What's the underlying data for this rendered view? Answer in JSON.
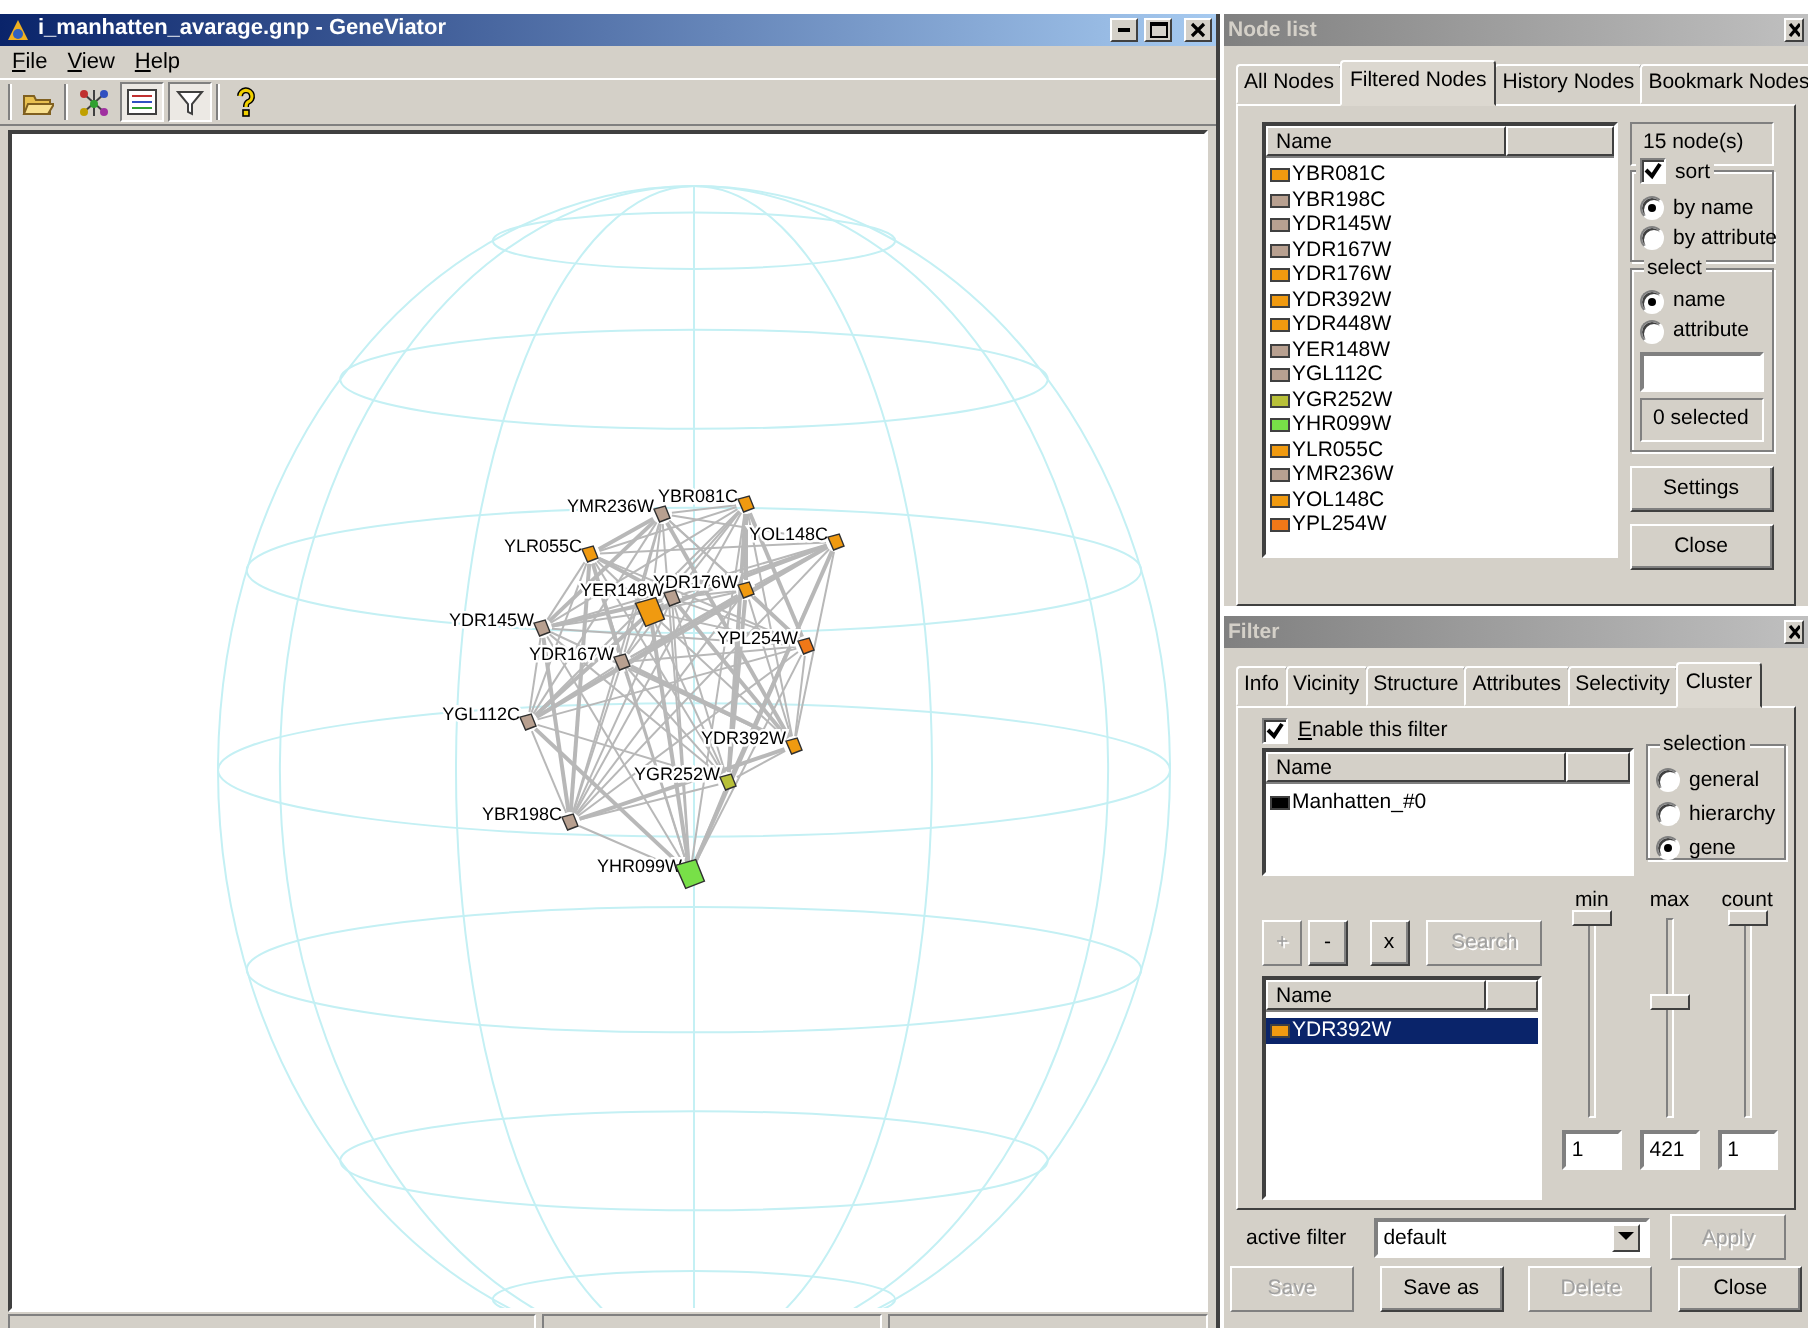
{
  "main_window": {
    "title": "i_manhatten_avarage.gnp - GeneViator",
    "menu": [
      "File",
      "View",
      "Help"
    ],
    "toolbar": [
      {
        "kind": "open",
        "pressed": false
      },
      {
        "kind": "layout",
        "pressed": false
      },
      {
        "kind": "list",
        "pressed": true
      },
      {
        "kind": "filter",
        "pressed": true
      },
      {
        "kind": "help",
        "pressed": false
      }
    ],
    "graph": {
      "nodes": [
        {
          "label": "YBR081C",
          "color": "#f09a10"
        },
        {
          "label": "YMR236W",
          "color": "#b8a090"
        },
        {
          "label": "YOL148C",
          "color": "#f09a10"
        },
        {
          "label": "YLR055C",
          "color": "#f09a10"
        },
        {
          "label": "YDR176W",
          "color": "#f09a10"
        },
        {
          "label": "YER148W",
          "color": "#b8a090"
        },
        {
          "color": "#f09a10"
        },
        {
          "label": "YDR145W",
          "color": "#b8a090"
        },
        {
          "label": "YPL254W",
          "color": "#f07818"
        },
        {
          "label": "YDR167W",
          "color": "#b8a090"
        },
        {
          "label": "YGL112C",
          "color": "#b8a090"
        },
        {
          "label": "YDR392W",
          "color": "#f09a10"
        },
        {
          "label": "YGR252W",
          "color": "#b8c038"
        },
        {
          "label": "YBR198C",
          "color": "#b8a090"
        },
        {
          "label": "YHR099W",
          "color": "#78e048"
        }
      ]
    }
  },
  "node_list": {
    "title": "Node list",
    "tabs": [
      {
        "label": "All Nodes",
        "selected": false
      },
      {
        "label": "Filtered Nodes",
        "selected": true
      },
      {
        "label": "History Nodes",
        "selected": false
      },
      {
        "label": "Bookmark Nodes",
        "selected": false
      }
    ],
    "columns": [
      "Name"
    ],
    "items": [
      {
        "name": "YBR081C",
        "color": "#f09a10"
      },
      {
        "name": "YBR198C",
        "color": "#b8a090"
      },
      {
        "name": "YDR145W",
        "color": "#b8a090"
      },
      {
        "name": "YDR167W",
        "color": "#b8a090"
      },
      {
        "name": "YDR176W",
        "color": "#f09a10"
      },
      {
        "name": "YDR392W",
        "color": "#f09a10"
      },
      {
        "name": "YDR448W",
        "color": "#f09a10"
      },
      {
        "name": "YER148W",
        "color": "#b8a090"
      },
      {
        "name": "YGL112C",
        "color": "#b8a090"
      },
      {
        "name": "YGR252W",
        "color": "#b8c038"
      },
      {
        "name": "YHR099W",
        "color": "#78e048"
      },
      {
        "name": "YLR055C",
        "color": "#f09a10"
      },
      {
        "name": "YMR236W",
        "color": "#b8a090"
      },
      {
        "name": "YOL148C",
        "color": "#f09a10"
      },
      {
        "name": "YPL254W",
        "color": "#f07818"
      }
    ],
    "count": "15 node(s)",
    "sort": {
      "label": "sort",
      "checked": true,
      "options": [
        {
          "label": "by name",
          "selected": true
        },
        {
          "label": "by attribute",
          "selected": false
        }
      ]
    },
    "select": {
      "label": "select",
      "options": [
        {
          "label": "name",
          "selected": true
        },
        {
          "label": "attribute",
          "selected": false
        }
      ],
      "status": "0 selected"
    },
    "buttons": [
      "Settings",
      "Close"
    ]
  },
  "filter": {
    "title": "Filter",
    "tabs": [
      {
        "label": "Info",
        "selected": false
      },
      {
        "label": "Vicinity",
        "selected": false
      },
      {
        "label": "Structure",
        "selected": false
      },
      {
        "label": "Attributes",
        "selected": false
      },
      {
        "label": "Selectivity",
        "selected": false
      },
      {
        "label": "Cluster",
        "selected": true
      }
    ],
    "enable": {
      "label": "Enable this filter",
      "checked": true
    },
    "clusters": {
      "columns": [
        "Name"
      ],
      "items": [
        {
          "name": "Manhatten_#0",
          "color": "#000000"
        }
      ]
    },
    "selection": {
      "label": "selection",
      "options": [
        {
          "label": "general",
          "selected": false
        },
        {
          "label": "hierarchy",
          "selected": false
        },
        {
          "label": "gene",
          "selected": true
        }
      ]
    },
    "tools": [
      {
        "label": "+",
        "disabled": true
      },
      {
        "label": "-",
        "disabled": false
      },
      {
        "label": "x",
        "disabled": false
      },
      {
        "label": "Search",
        "disabled": true
      }
    ],
    "genes": {
      "columns": [
        "Name"
      ],
      "items": [
        {
          "name": "YDR392W",
          "color": "#f09a10",
          "selected": true
        }
      ]
    },
    "sliders": [
      {
        "label": "min",
        "level": 1,
        "value": "1"
      },
      {
        "label": "max",
        "level": 0.58,
        "value": "421"
      },
      {
        "label": "count",
        "level": 1,
        "value": "1"
      }
    ],
    "active_filter": {
      "label": "active filter",
      "value": "default"
    },
    "apply": {
      "label": "Apply",
      "disabled": true
    },
    "bottom_buttons": [
      {
        "label": "Save",
        "disabled": true
      },
      {
        "label": "Save as",
        "disabled": false
      },
      {
        "label": "Delete",
        "disabled": true
      },
      {
        "label": "Close",
        "disabled": false
      }
    ]
  }
}
